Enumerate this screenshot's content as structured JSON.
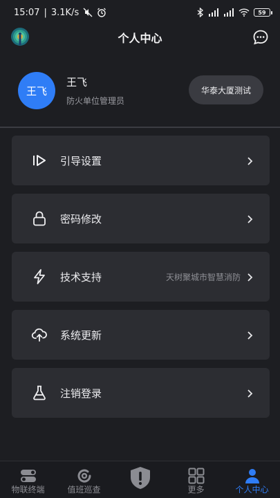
{
  "status_bar": {
    "time": "15:07",
    "network_speed": "3.1K/s",
    "battery": "59"
  },
  "header": {
    "title": "个人中心",
    "logo_icon": "peacock-logo-icon",
    "action_icon": "chat-bubble-icon"
  },
  "profile": {
    "avatar_text": "王飞",
    "name": "王飞",
    "role": "防火单位管理员",
    "org_button": "华泰大厦测试",
    "avatar_color": "#2f7df6"
  },
  "menu": {
    "items": [
      {
        "label": "引导设置",
        "value": "",
        "icon": "guide-play-icon"
      },
      {
        "label": "密码修改",
        "value": "",
        "icon": "lock-icon"
      },
      {
        "label": "技术支持",
        "value": "天树聚城市智慧消防",
        "icon": "lightning-icon"
      },
      {
        "label": "系统更新",
        "value": "",
        "icon": "cloud-upload-icon"
      },
      {
        "label": "注销登录",
        "value": "",
        "icon": "flask-icon"
      }
    ]
  },
  "tabs": [
    {
      "label": "物联终端",
      "icon": "toggle-switch-icon",
      "active": false
    },
    {
      "label": "值班巡查",
      "icon": "patrol-target-icon",
      "active": false
    },
    {
      "label": "",
      "icon": "shield-alert-icon",
      "active": false
    },
    {
      "label": "更多",
      "icon": "grid-apps-icon",
      "active": false
    },
    {
      "label": "个人中心",
      "icon": "person-icon",
      "active": true
    }
  ],
  "colors": {
    "accent": "#2f7df6",
    "background": "#1d1e22",
    "card": "#2c2d32"
  }
}
